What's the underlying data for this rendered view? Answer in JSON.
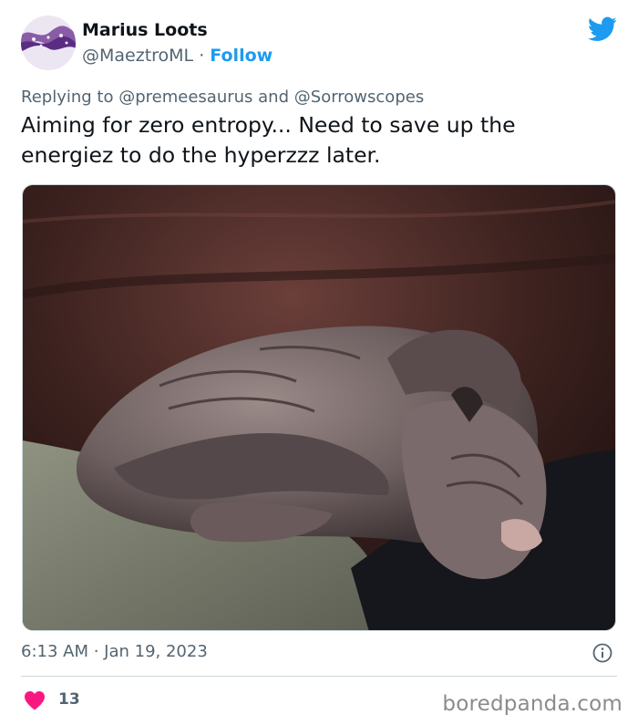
{
  "author": {
    "name": "Marius Loots",
    "handle": "@MaeztroML",
    "separator": "·",
    "follow_label": "Follow"
  },
  "reply": {
    "prefix": "Replying to",
    "mention_1": "@premeesaurus",
    "conjunction": "and",
    "mention_2": "@Sorrowscopes"
  },
  "tweet": {
    "text": "Aiming for zero entropy... Need to save up the energiez to do the hyperzzz later.",
    "timestamp": "6:13 AM · Jan 19, 2023"
  },
  "engagement": {
    "likes": "13"
  },
  "watermark": "boredpanda.com",
  "icons": {
    "brand": "twitter-bird-icon",
    "info": "info-icon",
    "like": "heart-icon"
  },
  "colors": {
    "link": "#1d9bf0",
    "secondary_text": "#536471",
    "heart": "#f91880",
    "divider": "#cfd9de"
  }
}
